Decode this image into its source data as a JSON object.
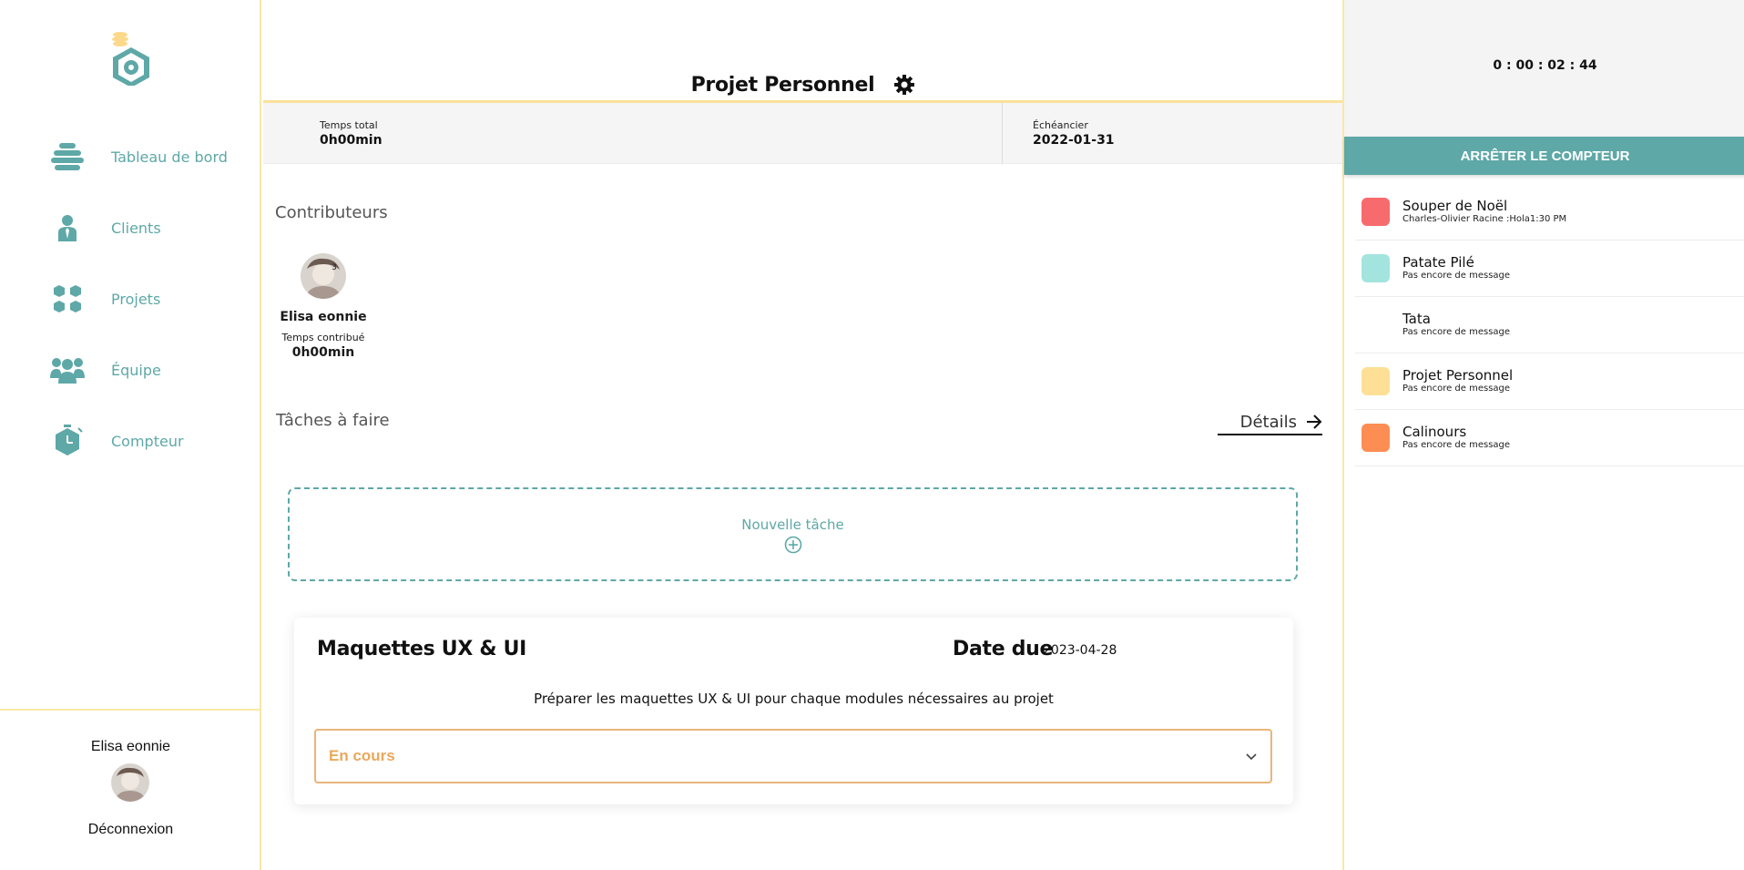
{
  "sidebar": {
    "items": [
      {
        "label": "Tableau de bord",
        "icon": "dashboard-icon"
      },
      {
        "label": "Clients",
        "icon": "client-icon"
      },
      {
        "label": "Projets",
        "icon": "projects-icon"
      },
      {
        "label": "Équipe",
        "icon": "team-icon"
      },
      {
        "label": "Compteur",
        "icon": "timer-icon"
      }
    ],
    "user_name": "Elisa eonnie",
    "logout_label": "Déconnexion"
  },
  "main": {
    "title": "Projet Personnel",
    "stats": {
      "total_time_label": "Temps total",
      "total_time_value": "0h00min",
      "schedule_label": "Échéancier",
      "schedule_value": "2022-01-31"
    },
    "contributors_title": "Contributeurs",
    "contributors": [
      {
        "name": "Elisa eonnie",
        "label": "Temps contribué",
        "time": "0h00min"
      }
    ],
    "tasks_title": "Tâches à faire",
    "details_label": "Détails",
    "new_task_label": "Nouvelle tâche",
    "task": {
      "title": "Maquettes UX & UI",
      "due_label": "Date due",
      "due_value": "2023-04-28",
      "description": "Préparer les maquettes UX & UI pour chaque modules nécessaires au projet",
      "status": "En cours"
    }
  },
  "right": {
    "timer": "0 : 00 : 02 : 44",
    "stop_label": "ARRÊTER LE COMPTEUR",
    "projects": [
      {
        "name": "Souper de Noël",
        "message": "Charles-Olivier Racine :Hola1:30 PM",
        "color": "#f76b6e"
      },
      {
        "name": "Patate Pilé",
        "message": "Pas encore de message",
        "color": "#a3e4df"
      },
      {
        "name": "Tata",
        "message": "Pas encore de message",
        "color": "#ffffff"
      },
      {
        "name": "Projet Personnel",
        "message": "Pas encore de message",
        "color": "#fde096"
      },
      {
        "name": "Calinours",
        "message": "Pas encore de message",
        "color": "#fc8e54"
      }
    ]
  },
  "colors": {
    "accent": "#5ea8a7",
    "border_yellow": "#fbe7a6",
    "status": "#eaa85a"
  }
}
